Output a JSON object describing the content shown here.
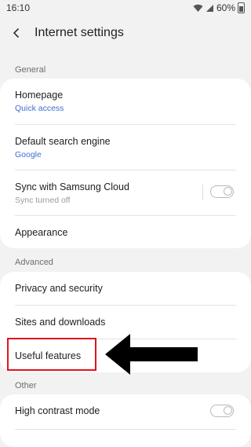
{
  "status_bar": {
    "time": "16:10",
    "battery": "60%"
  },
  "header": {
    "title": "Internet settings"
  },
  "sections": {
    "general": "General",
    "advanced": "Advanced",
    "other": "Other"
  },
  "general_items": {
    "homepage": {
      "title": "Homepage",
      "subtitle": "Quick access"
    },
    "search_engine": {
      "title": "Default search engine",
      "subtitle": "Google"
    },
    "sync": {
      "title": "Sync with Samsung Cloud",
      "subtitle": "Sync turned off",
      "enabled": false
    },
    "appearance": {
      "title": "Appearance"
    }
  },
  "advanced_items": {
    "privacy": {
      "title": "Privacy and security"
    },
    "sites": {
      "title": "Sites and downloads"
    },
    "useful": {
      "title": "Useful features"
    }
  },
  "other_items": {
    "high_contrast": {
      "title": "High contrast mode",
      "enabled": false
    }
  },
  "colors": {
    "accent": "#3f6fd1",
    "highlight": "#e0141e",
    "arrow": "#000000"
  }
}
